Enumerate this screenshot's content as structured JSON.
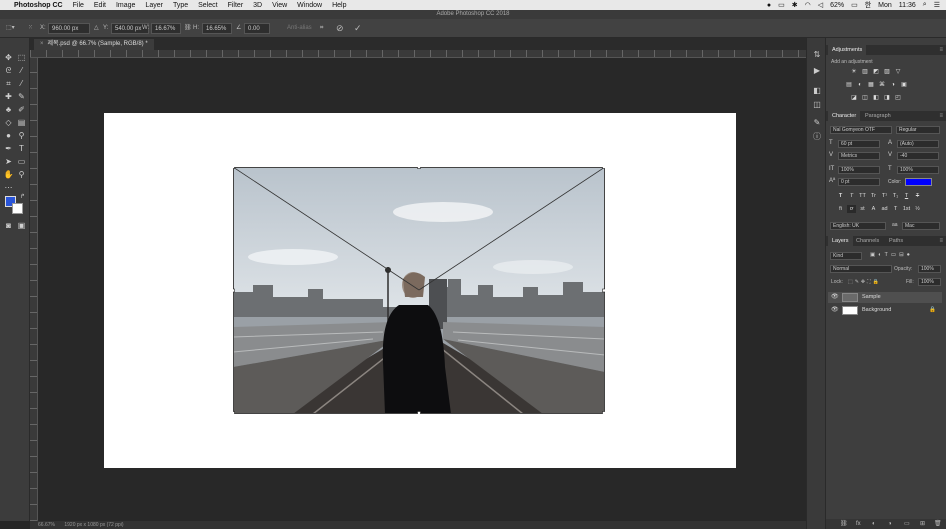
{
  "menubar": {
    "app": "Photoshop CC",
    "items": [
      "File",
      "Edit",
      "Image",
      "Layer",
      "Type",
      "Select",
      "Filter",
      "3D",
      "View",
      "Window",
      "Help"
    ],
    "battery": "62%",
    "day": "Mon",
    "time": "11:36"
  },
  "window": {
    "title": "Adobe Photoshop CC 2018"
  },
  "options": {
    "x_label": "X:",
    "x_value": "960.00 px",
    "y_label": "Y:",
    "y_value": "540.00 px",
    "w_label": "W:",
    "w_value": "16.67%",
    "h_label": "H:",
    "h_value": "16.65%",
    "angle_value": "0.00",
    "interp_label": "Anti-alias"
  },
  "document": {
    "tab_title": "제목.psd @ 66.7% (Sample, RGB/8) *",
    "photo_colors": {
      "sky": "#c9d1d9",
      "city": "#6c6f72",
      "deck": "#3a3634",
      "coat": "#0d0d0f"
    }
  },
  "status": {
    "zoom": "66.67%",
    "doc_info": "1920 px x 1080 px (72 ppi)"
  },
  "colors": {
    "foreground": "#2a55d9",
    "background": "#ffffff",
    "text_color": "#0000ff"
  },
  "adjustments": {
    "tab": "Adjustments",
    "hint": "Add an adjustment",
    "row1": [
      "☀",
      "▥",
      "◩",
      "▨",
      "▽"
    ],
    "row2": [
      "▤",
      "◐",
      "▦",
      "⌘",
      "◑",
      "▣"
    ],
    "row3": [
      "◪",
      "◫",
      "◧",
      "◨",
      "◰"
    ]
  },
  "character": {
    "tabs": [
      "Character",
      "Paragraph"
    ],
    "font_family": "Nal Gomyeon OTF",
    "font_style": "Regular",
    "size": "60 pt",
    "leading": "(Auto)",
    "kerning": "Metrics",
    "tracking": "-40",
    "scale_v": "100%",
    "scale_h": "100%",
    "baseline": "0 pt",
    "color_label": "Color:",
    "styles": [
      "T",
      "T",
      "TT",
      "Tr",
      "T¹",
      "T₁",
      "T",
      "T"
    ],
    "opentype": [
      "fi",
      "ơ",
      "st",
      "A",
      "ad",
      "T",
      "1st",
      "½"
    ],
    "language": "English: UK",
    "aa_mode": "Mac"
  },
  "layers": {
    "tabs": [
      "Layers",
      "Channels",
      "Paths"
    ],
    "kind_label": "Kind",
    "blend_mode": "Normal",
    "opacity_label": "Opacity:",
    "opacity": "100%",
    "lock_label": "Lock:",
    "fill_label": "Fill:",
    "fill": "100%",
    "items": [
      {
        "name": "Sample",
        "visible": true
      },
      {
        "name": "Background",
        "visible": true
      }
    ],
    "footer": [
      "⛓",
      "fx",
      "◐",
      "◑",
      "▭",
      "⊞",
      "🗑"
    ]
  }
}
